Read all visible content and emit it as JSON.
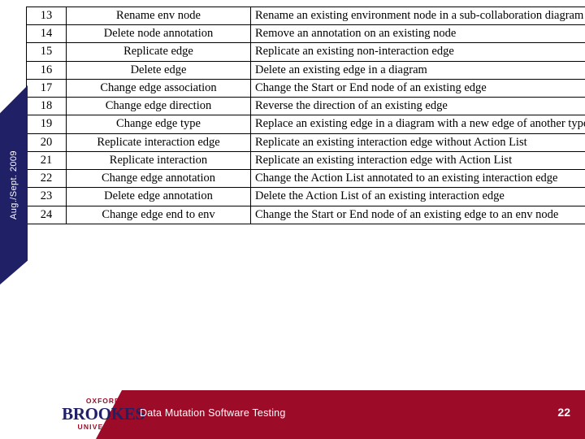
{
  "sidebar": {
    "date_label": "Aug./Sept. 2009",
    "color": "#1f2065"
  },
  "table": {
    "rows": [
      {
        "id": "13",
        "name": "Rename env node",
        "description": "Rename an existing environment node in a sub-collaboration diagram"
      },
      {
        "id": "14",
        "name": "Delete node annotation",
        "description": "Remove an annotation on an existing node"
      },
      {
        "id": "15",
        "name": "Replicate edge",
        "description": "Replicate an existing non-interaction edge"
      },
      {
        "id": "16",
        "name": "Delete edge",
        "description": "Delete an existing edge in a diagram"
      },
      {
        "id": "17",
        "name": "Change edge association",
        "description": "Change the Start or End node of an existing edge"
      },
      {
        "id": "18",
        "name": "Change edge direction",
        "description": "Reverse the direction of an existing edge"
      },
      {
        "id": "19",
        "name": "Change edge type",
        "description": "Replace an existing edge in a diagram with a new edge of another type"
      },
      {
        "id": "20",
        "name": "Replicate interaction edge",
        "description": "Replicate an existing interaction edge without Action List"
      },
      {
        "id": "21",
        "name": "Replicate interaction",
        "description": "Replicate an existing interaction edge with Action List"
      },
      {
        "id": "22",
        "name": "Change edge annotation",
        "description": "Change the Action List annotated to an existing interaction edge"
      },
      {
        "id": "23",
        "name": "Delete edge annotation",
        "description": "Delete the Action List of an existing interaction edge"
      },
      {
        "id": "24",
        "name": "Change edge end to env",
        "description": "Change the Start or End node of an existing edge to an env node"
      }
    ]
  },
  "footer": {
    "title": "Data Mutation Software Testing",
    "page_number": "22",
    "band_color": "#9c0b28",
    "logo": {
      "line1": "OXFORD",
      "line2": "BROOKES",
      "line3": "UNIVERSITY"
    }
  }
}
